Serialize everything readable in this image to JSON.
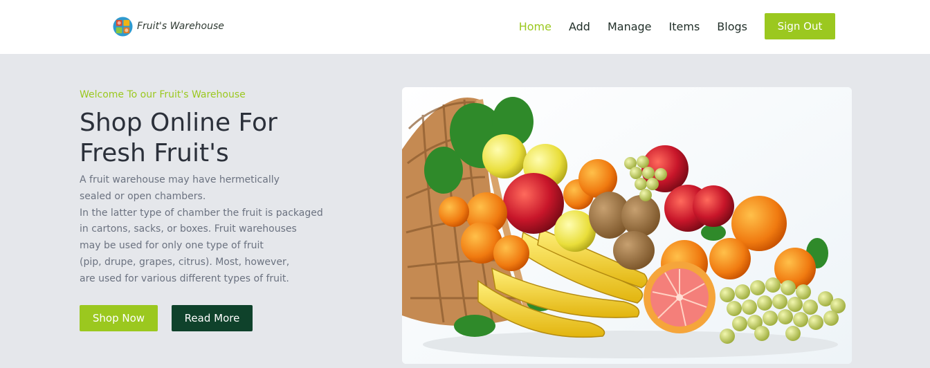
{
  "brand": {
    "name": "Fruit's Warehouse",
    "logo_icon": "fruit-logo-icon"
  },
  "nav": {
    "items": [
      {
        "label": "Home",
        "active": true
      },
      {
        "label": "Add",
        "active": false
      },
      {
        "label": "Manage",
        "active": false
      },
      {
        "label": "Items",
        "active": false
      },
      {
        "label": "Blogs",
        "active": false
      }
    ],
    "signout_label": "Sign Out"
  },
  "hero": {
    "welcome": "Welcome To our Fruit's Warehouse",
    "title_lines": [
      "Shop Online For",
      "Fresh Fruit's"
    ],
    "description_lines": [
      "A fruit warehouse may have hermetically",
      "sealed or open chambers.",
      "In the latter type of chamber the fruit is packaged",
      "in cartons, sacks, or boxes. Fruit warehouses",
      "may be used for only one type of fruit",
      "(pip, drupe, grapes, citrus). Most, however,",
      "are used for various different types of fruit."
    ],
    "shop_button": "Shop Now",
    "read_button": "Read More"
  },
  "colors": {
    "accent": "#9bc81f",
    "dark_green": "#0f422b",
    "background": "#e5e7eb",
    "heading": "#2b303a",
    "body_text": "#6b7280"
  }
}
